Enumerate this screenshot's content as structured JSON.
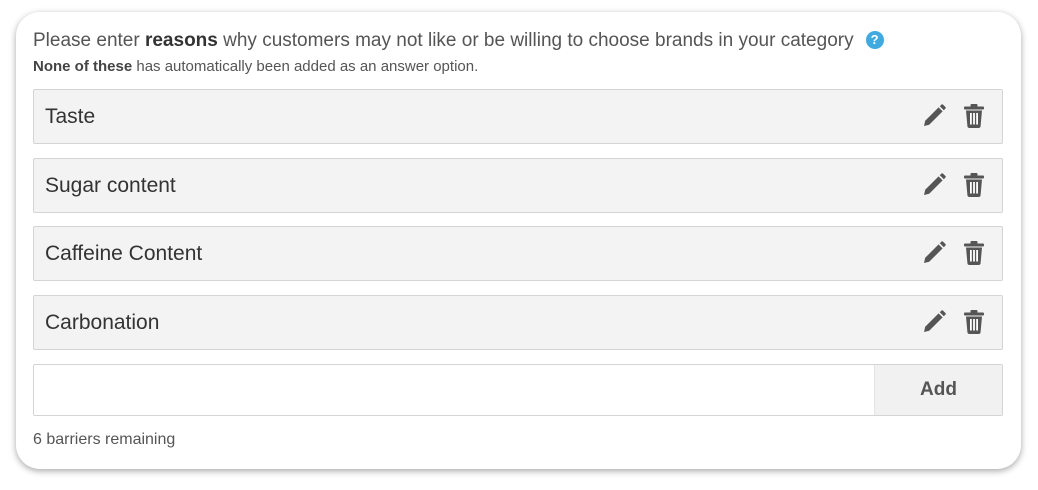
{
  "prompt": {
    "prefix": "Please enter ",
    "emphasis": "reasons",
    "suffix": " why customers may not like or be willing to choose brands in your category",
    "help_icon": "question-circle-icon",
    "help_glyph": "?"
  },
  "note": {
    "emphasis": "None of these",
    "suffix": " has automatically been added as an answer option."
  },
  "items": [
    {
      "label": "Taste"
    },
    {
      "label": "Sugar content"
    },
    {
      "label": "Caffeine Content"
    },
    {
      "label": "Carbonation"
    }
  ],
  "item_icons": {
    "edit": "pencil-icon",
    "delete": "trash-icon",
    "color": "#555555"
  },
  "add": {
    "input_value": "",
    "placeholder": "",
    "button_label": "Add"
  },
  "remaining_text": "6 barriers remaining",
  "colors": {
    "help_accent": "#3fa9e0",
    "item_background": "#f3f3f3"
  }
}
